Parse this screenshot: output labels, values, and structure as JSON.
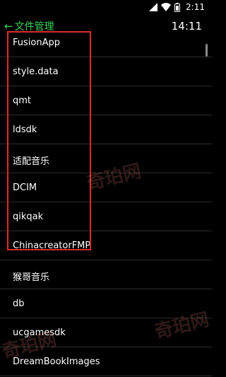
{
  "status_bar": {
    "time": "2:11",
    "icons": [
      "signal-icon",
      "wifi-icon",
      "battery-icon"
    ]
  },
  "header": {
    "back_icon": "←",
    "title": "文件管理",
    "clock": "14:11"
  },
  "files": [
    {
      "name": "FusionApp"
    },
    {
      "name": "style.data"
    },
    {
      "name": "qmt"
    },
    {
      "name": "ldsdk"
    },
    {
      "name": "适配音乐"
    },
    {
      "name": "DCIM"
    },
    {
      "name": "qikqak"
    },
    {
      "name": "ChinacreatorFMP"
    },
    {
      "name": "猴哥音乐"
    },
    {
      "name": "db"
    },
    {
      "name": "ucgamesdk"
    },
    {
      "name": "DreamBookImages"
    }
  ],
  "colors": {
    "accent": "#39d15c",
    "highlight": "#d92b2b",
    "background": "#000000"
  },
  "watermark": "奇珀网"
}
